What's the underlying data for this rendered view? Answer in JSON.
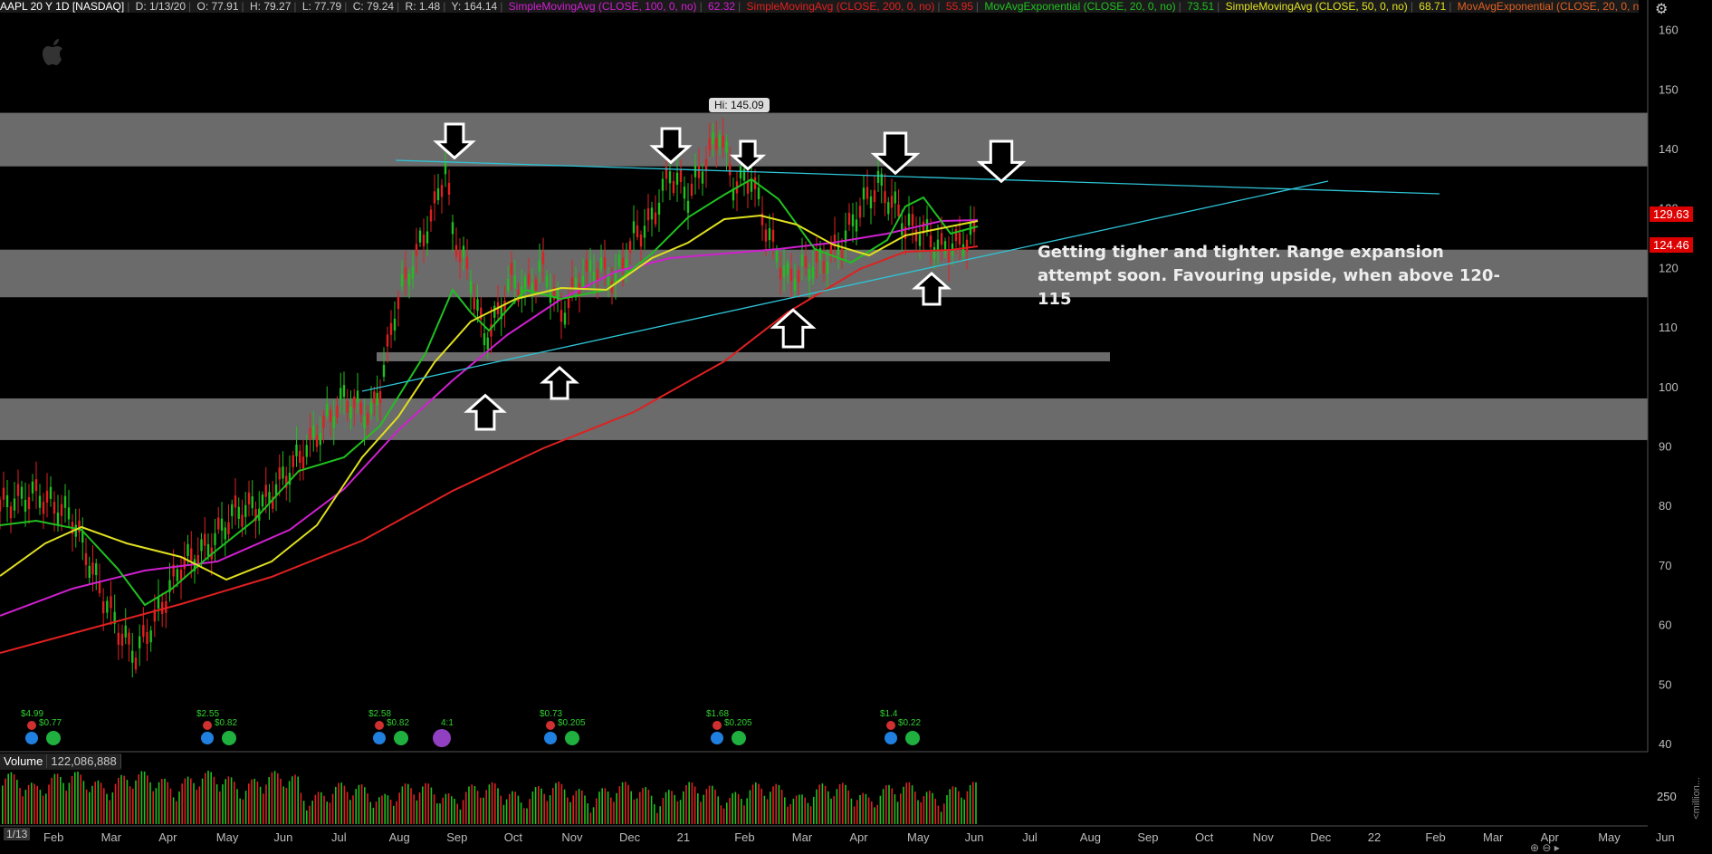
{
  "header": {
    "symbol": "AAPL 20 Y 1D [NASDAQ]",
    "date": "D: 1/13/20",
    "open": "O: 77.91",
    "high": "H: 79.27",
    "low": "L: 77.79",
    "close": "C: 79.24",
    "range": "R: 1.48",
    "yhigh": "Y: 164.14",
    "studies": [
      {
        "label": "SimpleMovingAvg (CLOSE, 100, 0, no)",
        "value": "62.32",
        "color": "#d020d0"
      },
      {
        "label": "SimpleMovingAvg (CLOSE, 200, 0, no)",
        "value": "55.95",
        "color": "#e02020"
      },
      {
        "label": "MovAvgExponential (CLOSE, 20, 0, no)",
        "value": "73.51",
        "color": "#20c020"
      },
      {
        "label": "SimpleMovingAvg (CLOSE, 50, 0, no)",
        "value": "68.71",
        "color": "#e0e020"
      },
      {
        "label": "MovAvgExponential (CLOSE, 20, 0, no)...",
        "value": "",
        "color": "#e06020"
      }
    ]
  },
  "annotation": {
    "line1": "Getting tigher and tighter. Range expansion",
    "line2": "attempt soon. Favouring upside, when above 120-115"
  },
  "hi_label": "Hi: 145.09",
  "price_badges": {
    "last": "129.63",
    "ma": "124.46"
  },
  "volume": {
    "label": "Volume",
    "value": "122,086,888",
    "axis_tick": "250",
    "unit": "<million..."
  },
  "date_badge": "1/13",
  "events": [
    {
      "div": "$4.99",
      "eps": "$0.77"
    },
    {
      "div": "$2.55",
      "eps": "$0.82"
    },
    {
      "div": "$2.58",
      "eps": "$0.82",
      "split": "4:1"
    },
    {
      "div": "$0.73",
      "eps": "$0.205"
    },
    {
      "div": "$1.68",
      "eps": "$0.205"
    },
    {
      "div": "$1.4",
      "eps": "$0.22"
    }
  ],
  "chart_data": {
    "type": "line",
    "title": "AAPL 20 Y 1D [NASDAQ]",
    "xlabel": "",
    "ylabel": "",
    "ylim": [
      40,
      165
    ],
    "y_ticks": [
      40,
      50,
      60,
      70,
      80,
      90,
      100,
      110,
      120,
      130,
      140,
      150,
      160
    ],
    "x_ticks": [
      "Feb",
      "Mar",
      "Apr",
      "May",
      "Jun",
      "Jul",
      "Aug",
      "Sep",
      "Oct",
      "Nov",
      "Dec",
      "21",
      "Feb",
      "Mar",
      "Apr",
      "May",
      "Jun",
      "Jul",
      "Aug",
      "Sep",
      "Oct",
      "Nov",
      "Dec",
      "22",
      "Feb",
      "Mar",
      "Apr",
      "May",
      "Jun"
    ],
    "series": [
      {
        "name": "SimpleMovingAvg (CLOSE, 100, 0, no)",
        "values": [
          58,
          62,
          66,
          72,
          80,
          95,
          112,
          120,
          126,
          128,
          129
        ],
        "color": "#d020d0"
      },
      {
        "name": "SimpleMovingAvg (CLOSE, 200, 0, no)",
        "values": [
          56,
          60,
          64,
          68,
          74,
          85,
          98,
          108,
          116,
          122,
          124
        ],
        "color": "#e02020"
      },
      {
        "name": "MovAvgExponential (CLOSE, 20, 0, no)",
        "values": [
          73,
          62,
          75,
          85,
          97,
          118,
          114,
          131,
          122,
          133,
          127
        ],
        "color": "#20c020"
      },
      {
        "name": "SimpleMovingAvg (CLOSE, 50, 0, no)",
        "values": [
          68,
          75,
          69,
          78,
          94,
          112,
          118,
          128,
          127,
          128,
          128
        ],
        "color": "#e0e020"
      }
    ],
    "resistance_zones": [
      [
        137,
        146
      ],
      [
        115,
        123
      ],
      [
        91,
        98
      ]
    ],
    "support_line": 105,
    "grid": false,
    "legend": "top"
  }
}
